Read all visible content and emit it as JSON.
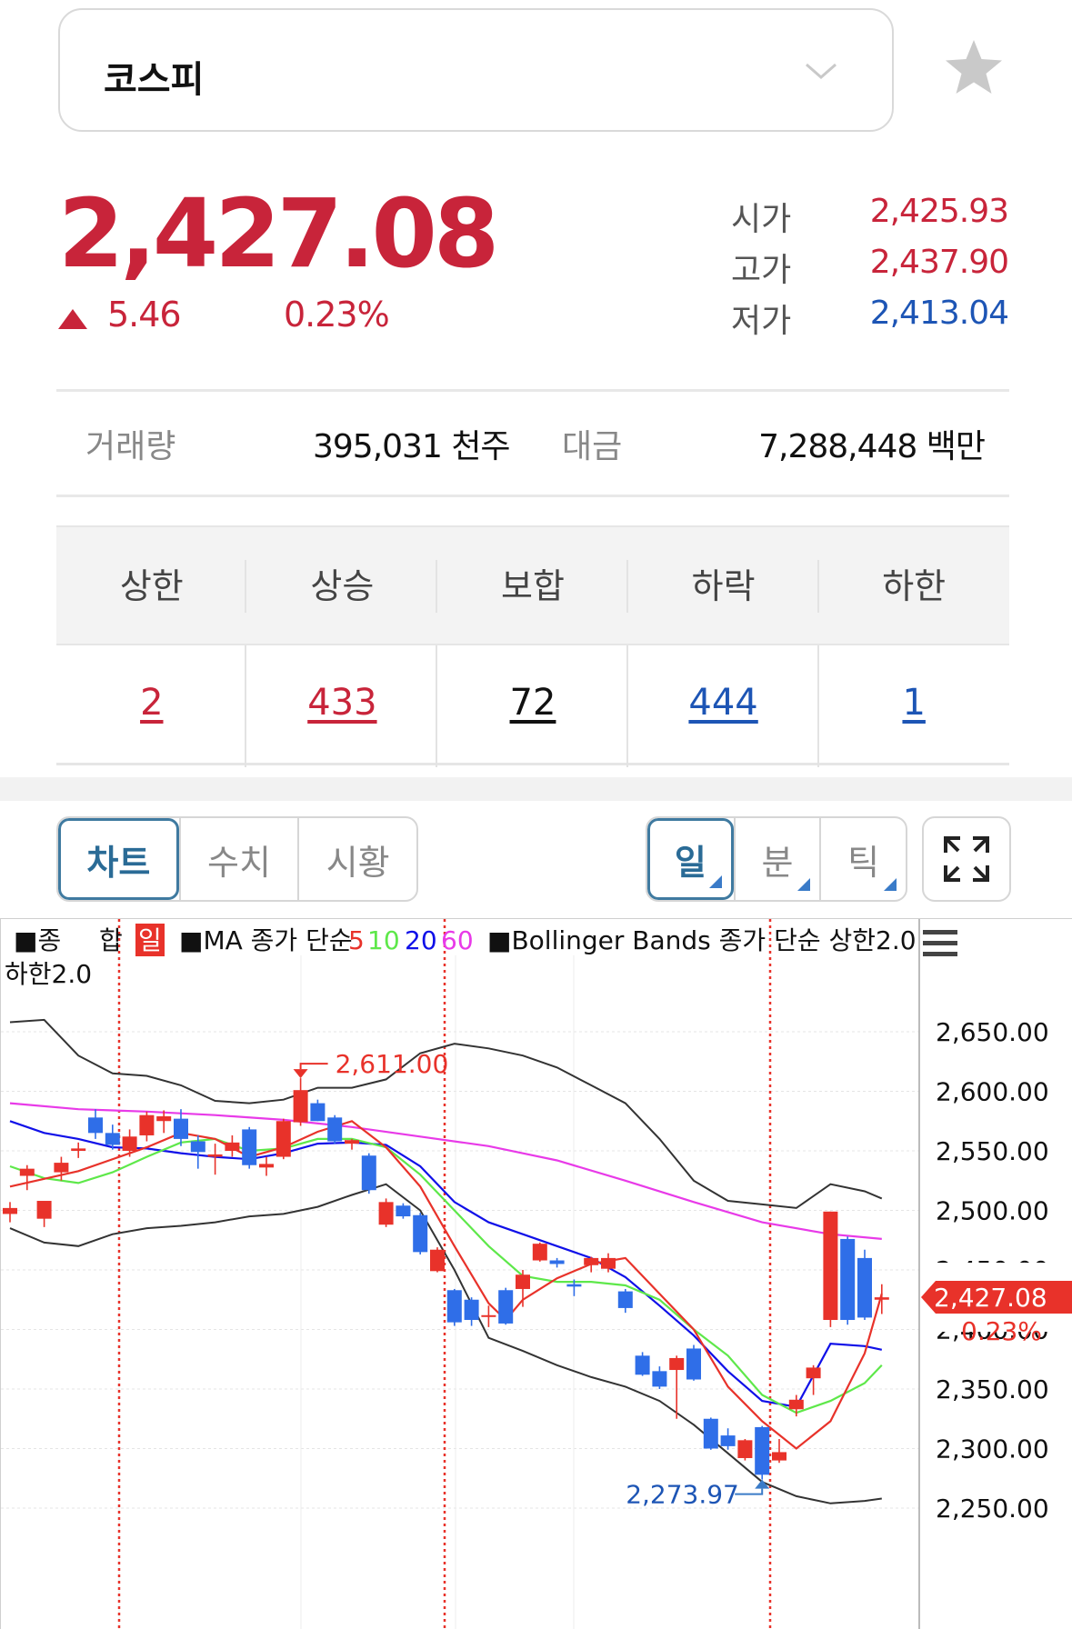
{
  "index": {
    "name": "코스피",
    "icon": "chevron-down-icon",
    "favorite_icon": "star-icon"
  },
  "quote": {
    "price": "2,427.08",
    "change": "5.46",
    "change_pct": "0.23%",
    "direction": "up",
    "open_label": "시가",
    "open": "2,425.93",
    "high_label": "고가",
    "high": "2,437.90",
    "low_label": "저가",
    "low": "2,413.04",
    "volume_label": "거래량",
    "volume": "395,031 천주",
    "amount_label": "대금",
    "amount": "7,288,448 백만"
  },
  "breadth": {
    "headers": [
      "상한",
      "상승",
      "보합",
      "하락",
      "하한"
    ],
    "values": [
      "2",
      "433",
      "72",
      "444",
      "1"
    ]
  },
  "view_tabs": [
    "차트",
    "수치",
    "시황"
  ],
  "period_tabs": [
    "일",
    "분",
    "틱"
  ],
  "colors": {
    "up": "#c8243a",
    "down": "#1d55b5",
    "candle_up": "#e8322a",
    "candle_down": "#2f6ee8"
  },
  "chart_data": {
    "type": "candlestick",
    "legend_line1": [
      "■종",
      "합",
      "일",
      "■MA 종가 단순",
      "5",
      "10",
      "20",
      "60",
      "■Bollinger Bands 종가 단순 상한2.0"
    ],
    "legend_line2": "하한2.0",
    "y_ticks": [
      "2,650.00",
      "2,600.00",
      "2,550.00",
      "2,500.00",
      "2,450.00",
      "2,350.00",
      "2,300.00",
      "2,250.00"
    ],
    "ylim": [
      2250,
      2650
    ],
    "max_label": "2,611.00",
    "min_label": "2,273.97",
    "current_price_label": "2,427.08",
    "current_change_label": "0.23%",
    "candles": [
      {
        "o": 2497,
        "h": 2507,
        "l": 2490,
        "c": 2502
      },
      {
        "o": 2529,
        "h": 2538,
        "l": 2517,
        "c": 2535
      },
      {
        "o": 2493,
        "h": 2504,
        "l": 2486,
        "c": 2508
      },
      {
        "o": 2532,
        "h": 2545,
        "l": 2525,
        "c": 2540
      },
      {
        "o": 2550,
        "h": 2557,
        "l": 2544,
        "c": 2552
      },
      {
        "o": 2578,
        "h": 2585,
        "l": 2560,
        "c": 2565
      },
      {
        "o": 2565,
        "h": 2572,
        "l": 2551,
        "c": 2555
      },
      {
        "o": 2550,
        "h": 2568,
        "l": 2545,
        "c": 2562
      },
      {
        "o": 2563,
        "h": 2583,
        "l": 2558,
        "c": 2580
      },
      {
        "o": 2575,
        "h": 2584,
        "l": 2565,
        "c": 2579
      },
      {
        "o": 2577,
        "h": 2585,
        "l": 2554,
        "c": 2560
      },
      {
        "o": 2558,
        "h": 2563,
        "l": 2535,
        "c": 2549
      },
      {
        "o": 2545,
        "h": 2556,
        "l": 2530,
        "c": 2547
      },
      {
        "o": 2550,
        "h": 2563,
        "l": 2545,
        "c": 2557
      },
      {
        "o": 2568,
        "h": 2570,
        "l": 2535,
        "c": 2538
      },
      {
        "o": 2536,
        "h": 2545,
        "l": 2529,
        "c": 2539
      },
      {
        "o": 2545,
        "h": 2577,
        "l": 2543,
        "c": 2575
      },
      {
        "o": 2574,
        "h": 2611,
        "l": 2571,
        "c": 2601
      },
      {
        "o": 2590,
        "h": 2593,
        "l": 2575,
        "c": 2575
      },
      {
        "o": 2578,
        "h": 2580,
        "l": 2556,
        "c": 2558
      },
      {
        "o": 2556,
        "h": 2560,
        "l": 2551,
        "c": 2559
      },
      {
        "o": 2546,
        "h": 2548,
        "l": 2514,
        "c": 2517
      },
      {
        "o": 2488,
        "h": 2510,
        "l": 2486,
        "c": 2507
      },
      {
        "o": 2504,
        "h": 2506,
        "l": 2493,
        "c": 2495
      },
      {
        "o": 2496,
        "h": 2498,
        "l": 2463,
        "c": 2465
      },
      {
        "o": 2449,
        "h": 2469,
        "l": 2448,
        "c": 2467
      },
      {
        "o": 2433,
        "h": 2434,
        "l": 2403,
        "c": 2406
      },
      {
        "o": 2425,
        "h": 2427,
        "l": 2403,
        "c": 2408
      },
      {
        "o": 2411,
        "h": 2420,
        "l": 2402,
        "c": 2412
      },
      {
        "o": 2433,
        "h": 2435,
        "l": 2404,
        "c": 2405
      },
      {
        "o": 2434,
        "h": 2450,
        "l": 2419,
        "c": 2446
      },
      {
        "o": 2458,
        "h": 2473,
        "l": 2457,
        "c": 2472
      },
      {
        "o": 2458,
        "h": 2460,
        "l": 2452,
        "c": 2455
      },
      {
        "o": 2438,
        "h": 2442,
        "l": 2428,
        "c": 2436
      },
      {
        "o": 2454,
        "h": 2461,
        "l": 2448,
        "c": 2460
      },
      {
        "o": 2451,
        "h": 2464,
        "l": 2448,
        "c": 2460
      },
      {
        "o": 2432,
        "h": 2434,
        "l": 2414,
        "c": 2418
      },
      {
        "o": 2378,
        "h": 2381,
        "l": 2361,
        "c": 2362
      },
      {
        "o": 2365,
        "h": 2369,
        "l": 2350,
        "c": 2352
      },
      {
        "o": 2366,
        "h": 2378,
        "l": 2325,
        "c": 2376
      },
      {
        "o": 2384,
        "h": 2387,
        "l": 2357,
        "c": 2358
      },
      {
        "o": 2325,
        "h": 2326,
        "l": 2299,
        "c": 2300
      },
      {
        "o": 2311,
        "h": 2317,
        "l": 2299,
        "c": 2302
      },
      {
        "o": 2292,
        "h": 2308,
        "l": 2290,
        "c": 2307
      },
      {
        "o": 2318,
        "h": 2319,
        "l": 2274,
        "c": 2278
      },
      {
        "o": 2290,
        "h": 2308,
        "l": 2288,
        "c": 2297
      },
      {
        "o": 2333,
        "h": 2345,
        "l": 2327,
        "c": 2341
      },
      {
        "o": 2359,
        "h": 2370,
        "l": 2345,
        "c": 2368
      },
      {
        "o": 2408,
        "h": 2499,
        "l": 2402,
        "c": 2499
      },
      {
        "o": 2476,
        "h": 2478,
        "l": 2404,
        "c": 2408
      },
      {
        "o": 2460,
        "h": 2467,
        "l": 2408,
        "c": 2410
      },
      {
        "o": 2425,
        "h": 2438,
        "l": 2413,
        "c": 2427
      }
    ],
    "ma5": [
      [
        0,
        2520
      ],
      [
        4,
        2533
      ],
      [
        8,
        2553
      ],
      [
        10,
        2565
      ],
      [
        12,
        2560
      ],
      [
        14,
        2545
      ],
      [
        16,
        2553
      ],
      [
        18,
        2566
      ],
      [
        20,
        2575
      ],
      [
        22,
        2553
      ],
      [
        24,
        2520
      ],
      [
        26,
        2470
      ],
      [
        28,
        2422
      ],
      [
        29,
        2408
      ],
      [
        30,
        2425
      ],
      [
        32,
        2443
      ],
      [
        34,
        2455
      ],
      [
        36,
        2460
      ],
      [
        38,
        2430
      ],
      [
        40,
        2400
      ],
      [
        42,
        2352
      ],
      [
        44,
        2323
      ],
      [
        46,
        2300
      ],
      [
        48,
        2323
      ],
      [
        50,
        2380
      ],
      [
        51,
        2430
      ]
    ],
    "ma10": [
      [
        0,
        2537
      ],
      [
        2,
        2527
      ],
      [
        4,
        2523
      ],
      [
        6,
        2532
      ],
      [
        8,
        2545
      ],
      [
        10,
        2557
      ],
      [
        12,
        2560
      ],
      [
        14,
        2550
      ],
      [
        16,
        2552
      ],
      [
        18,
        2560
      ],
      [
        20,
        2560
      ],
      [
        22,
        2553
      ],
      [
        24,
        2530
      ],
      [
        26,
        2500
      ],
      [
        28,
        2470
      ],
      [
        30,
        2445
      ],
      [
        32,
        2440
      ],
      [
        34,
        2440
      ],
      [
        36,
        2437
      ],
      [
        38,
        2425
      ],
      [
        40,
        2400
      ],
      [
        42,
        2378
      ],
      [
        44,
        2345
      ],
      [
        46,
        2330
      ],
      [
        48,
        2340
      ],
      [
        50,
        2355
      ],
      [
        51,
        2370
      ]
    ],
    "ma20": [
      [
        0,
        2575
      ],
      [
        2,
        2565
      ],
      [
        4,
        2560
      ],
      [
        6,
        2553
      ],
      [
        8,
        2552
      ],
      [
        10,
        2548
      ],
      [
        12,
        2545
      ],
      [
        14,
        2543
      ],
      [
        16,
        2548
      ],
      [
        18,
        2556
      ],
      [
        20,
        2557
      ],
      [
        22,
        2555
      ],
      [
        24,
        2537
      ],
      [
        26,
        2507
      ],
      [
        28,
        2490
      ],
      [
        30,
        2480
      ],
      [
        32,
        2470
      ],
      [
        34,
        2460
      ],
      [
        36,
        2444
      ],
      [
        38,
        2420
      ],
      [
        40,
        2395
      ],
      [
        42,
        2365
      ],
      [
        44,
        2340
      ],
      [
        46,
        2335
      ],
      [
        48,
        2388
      ],
      [
        50,
        2386
      ],
      [
        51,
        2383
      ]
    ],
    "ma60": [
      [
        0,
        2590
      ],
      [
        4,
        2585
      ],
      [
        8,
        2583
      ],
      [
        12,
        2580
      ],
      [
        16,
        2576
      ],
      [
        20,
        2570
      ],
      [
        24,
        2562
      ],
      [
        28,
        2554
      ],
      [
        32,
        2542
      ],
      [
        36,
        2525
      ],
      [
        40,
        2507
      ],
      [
        44,
        2490
      ],
      [
        48,
        2480
      ],
      [
        51,
        2476
      ]
    ],
    "bb_upper": [
      [
        0,
        2658
      ],
      [
        2,
        2660
      ],
      [
        4,
        2630
      ],
      [
        6,
        2615
      ],
      [
        8,
        2613
      ],
      [
        10,
        2605
      ],
      [
        12,
        2592
      ],
      [
        14,
        2590
      ],
      [
        16,
        2593
      ],
      [
        18,
        2603
      ],
      [
        20,
        2603
      ],
      [
        22,
        2610
      ],
      [
        24,
        2632
      ],
      [
        26,
        2640
      ],
      [
        28,
        2636
      ],
      [
        30,
        2630
      ],
      [
        32,
        2620
      ],
      [
        34,
        2605
      ],
      [
        36,
        2590
      ],
      [
        38,
        2560
      ],
      [
        40,
        2525
      ],
      [
        42,
        2508
      ],
      [
        44,
        2505
      ],
      [
        46,
        2502
      ],
      [
        48,
        2522
      ],
      [
        50,
        2516
      ],
      [
        51,
        2510
      ]
    ],
    "bb_lower": [
      [
        0,
        2485
      ],
      [
        2,
        2473
      ],
      [
        4,
        2470
      ],
      [
        6,
        2480
      ],
      [
        8,
        2485
      ],
      [
        10,
        2487
      ],
      [
        12,
        2490
      ],
      [
        14,
        2495
      ],
      [
        16,
        2497
      ],
      [
        18,
        2503
      ],
      [
        20,
        2513
      ],
      [
        22,
        2522
      ],
      [
        24,
        2500
      ],
      [
        26,
        2450
      ],
      [
        28,
        2393
      ],
      [
        30,
        2382
      ],
      [
        32,
        2370
      ],
      [
        34,
        2360
      ],
      [
        36,
        2352
      ],
      [
        38,
        2340
      ],
      [
        40,
        2320
      ],
      [
        42,
        2296
      ],
      [
        44,
        2272
      ],
      [
        46,
        2260
      ],
      [
        48,
        2254
      ],
      [
        50,
        2256
      ],
      [
        51,
        2258
      ]
    ]
  }
}
